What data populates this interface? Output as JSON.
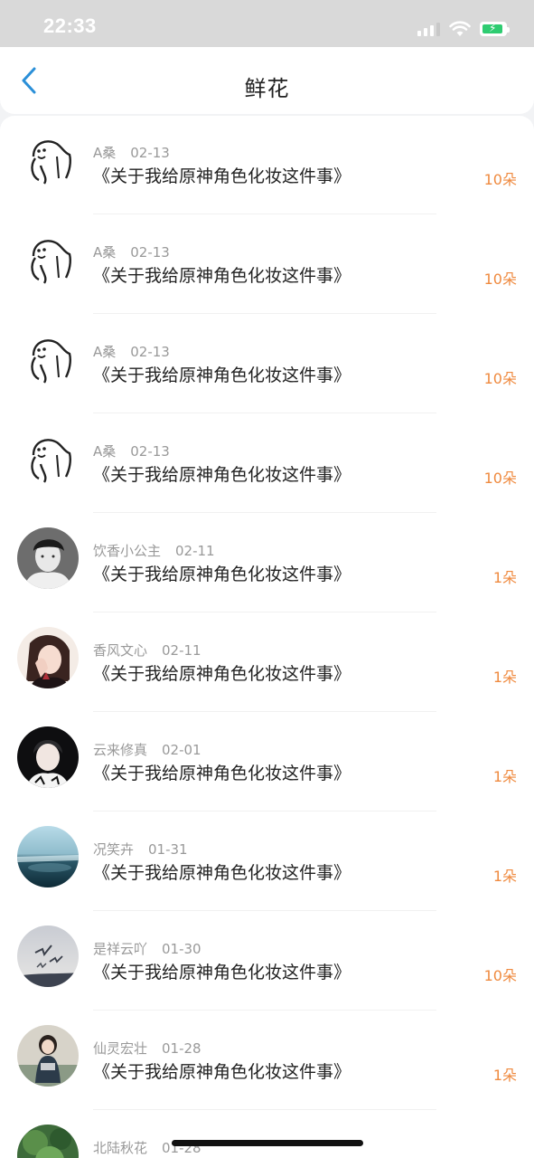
{
  "status_bar": {
    "time": "22:33"
  },
  "nav": {
    "title": "鲜花"
  },
  "items": [
    {
      "user": "A桑",
      "date": "02-13",
      "work": "《关于我给原神角色化妆这件事》",
      "amount": "10朵",
      "avatar": "sketch"
    },
    {
      "user": "A桑",
      "date": "02-13",
      "work": "《关于我给原神角色化妆这件事》",
      "amount": "10朵",
      "avatar": "sketch"
    },
    {
      "user": "A桑",
      "date": "02-13",
      "work": "《关于我给原神角色化妆这件事》",
      "amount": "10朵",
      "avatar": "sketch"
    },
    {
      "user": "A桑",
      "date": "02-13",
      "work": "《关于我给原神角色化妆这件事》",
      "amount": "10朵",
      "avatar": "sketch"
    },
    {
      "user": "饮香小公主",
      "date": "02-11",
      "work": "《关于我给原神角色化妆这件事》",
      "amount": "1朵",
      "avatar": "photo-man"
    },
    {
      "user": "香风文心",
      "date": "02-11",
      "work": "《关于我给原神角色化妆这件事》",
      "amount": "1朵",
      "avatar": "photo-girl"
    },
    {
      "user": "云来修真",
      "date": "02-01",
      "work": "《关于我给原神角色化妆这件事》",
      "amount": "1朵",
      "avatar": "photo-boy"
    },
    {
      "user": "况笑卉",
      "date": "01-31",
      "work": "《关于我给原神角色化妆这件事》",
      "amount": "1朵",
      "avatar": "photo-sea"
    },
    {
      "user": "是祥云吖",
      "date": "01-30",
      "work": "《关于我给原神角色化妆这件事》",
      "amount": "10朵",
      "avatar": "photo-birds"
    },
    {
      "user": "仙灵宏壮",
      "date": "01-28",
      "work": "《关于我给原神角色化妆这件事》",
      "amount": "1朵",
      "avatar": "photo-child"
    },
    {
      "user": "北陆秋花",
      "date": "01-28",
      "work": "",
      "amount": "",
      "avatar": "photo-green"
    }
  ],
  "colors": {
    "accent": "#ef8a3f",
    "back_icon": "#2a8fd8"
  }
}
